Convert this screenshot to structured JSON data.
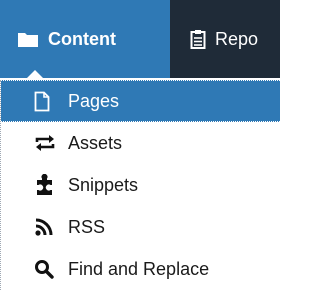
{
  "header": {
    "tabs": [
      {
        "label": "Content",
        "icon": "folder-icon",
        "active": true
      },
      {
        "label": "Repo",
        "icon": "clipboard-icon",
        "active": false
      }
    ]
  },
  "menu": {
    "items": [
      {
        "label": "Pages",
        "icon": "page-icon",
        "active": true
      },
      {
        "label": "Assets",
        "icon": "swap-arrows-icon",
        "active": false
      },
      {
        "label": "Snippets",
        "icon": "puzzle-icon",
        "active": false
      },
      {
        "label": "RSS",
        "icon": "rss-icon",
        "active": false
      },
      {
        "label": "Find and Replace",
        "icon": "search-icon",
        "active": false
      }
    ]
  },
  "colors": {
    "accent": "#2f79b5",
    "topbar": "#1f2b38",
    "text": "#1a1a1a"
  }
}
